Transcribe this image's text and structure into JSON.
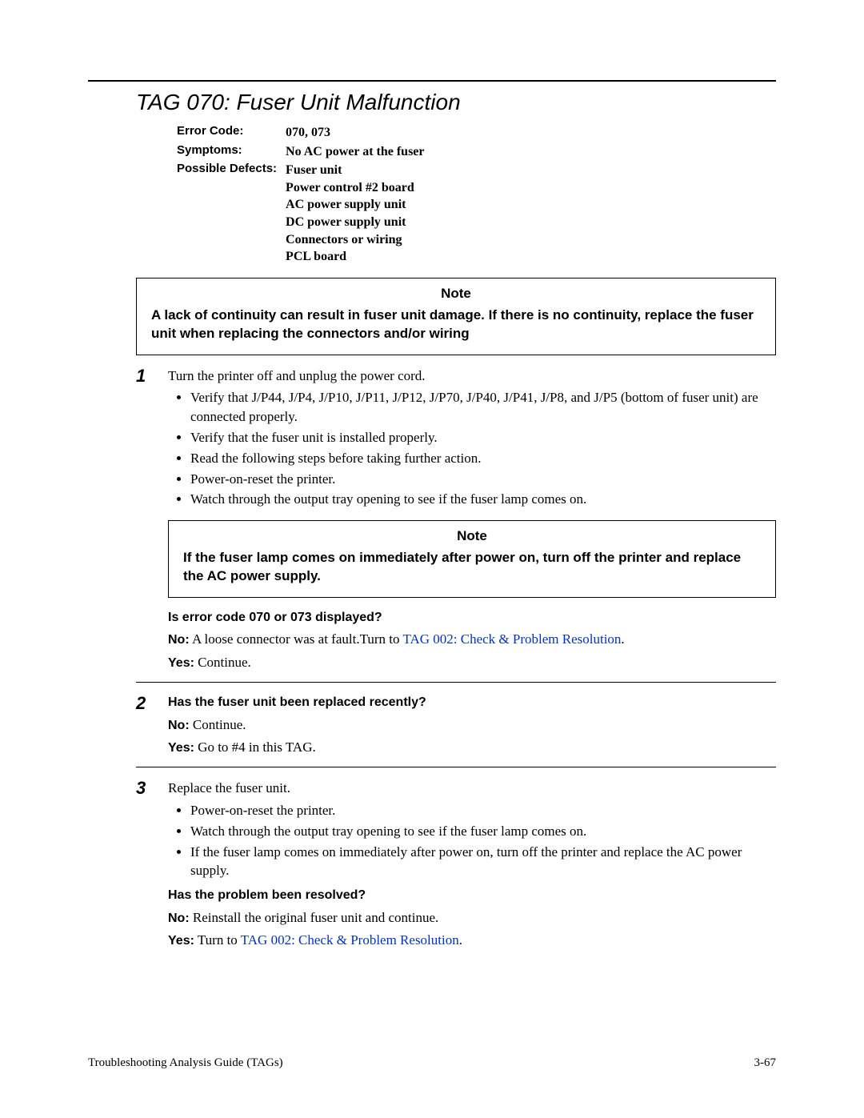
{
  "title": "TAG 070: Fuser Unit Malfunction",
  "info": {
    "error_code_label": "Error Code:",
    "error_code_value": "070, 073",
    "symptoms_label": "Symptoms:",
    "symptoms_value": "No AC power at the fuser",
    "defects_label": "Possible Defects:",
    "defects_value": "Fuser unit\nPower control #2 board\nAC power supply unit\nDC power supply unit\nConnectors or wiring\nPCL board"
  },
  "note1": {
    "header": "Note",
    "body": "A lack of continuity can result in fuser unit damage. If there is no continuity, replace the fuser unit when replacing the connectors and/or wiring"
  },
  "step1": {
    "num": "1",
    "intro": "Turn the printer off and unplug the power cord.",
    "b1": "Verify that J/P44, J/P4, J/P10, J/P11, J/P12, J/P70, J/P40, J/P41, J/P8, and J/P5 (bottom of fuser unit) are connected properly.",
    "b2": "Verify that the fuser unit is installed properly.",
    "b3": "Read the following steps before taking further action.",
    "b4": "Power-on-reset the printer.",
    "b5": "Watch through the output tray opening to see if the fuser lamp comes on.",
    "note_header": "Note",
    "note_body": "If the fuser lamp comes on immediately after power on, turn off the printer and replace the AC power supply.",
    "question": "Is error code 070 or 073 displayed?",
    "no_label": "No:",
    "no_text_a": "A loose connector was at fault.Turn to ",
    "no_link": "TAG 002: Check & Problem Resolution",
    "no_text_b": ".",
    "yes_label": "Yes:",
    "yes_text": "Continue."
  },
  "step2": {
    "num": "2",
    "question": "Has the fuser unit been replaced recently?",
    "no_label": "No:",
    "no_text": " Continue.",
    "yes_label": "Yes:",
    "yes_text": "Go to #4 in this TAG."
  },
  "step3": {
    "num": "3",
    "intro": "Replace the fuser unit.",
    "b1": "Power-on-reset the printer.",
    "b2": "Watch through the output tray opening to see if the fuser lamp comes on.",
    "b3": "If the fuser lamp comes on immediately after power on, turn off the printer and replace the AC power supply.",
    "question": "Has the problem been resolved?",
    "no_label": "No:",
    "no_text": " Reinstall the original fuser unit and continue.",
    "yes_label": "Yes:",
    "yes_text_a": "Turn to ",
    "yes_link": "TAG 002: Check & Problem Resolution",
    "yes_text_b": "."
  },
  "footer": {
    "left": "Troubleshooting Analysis Guide (TAGs)",
    "right": "3-67"
  }
}
